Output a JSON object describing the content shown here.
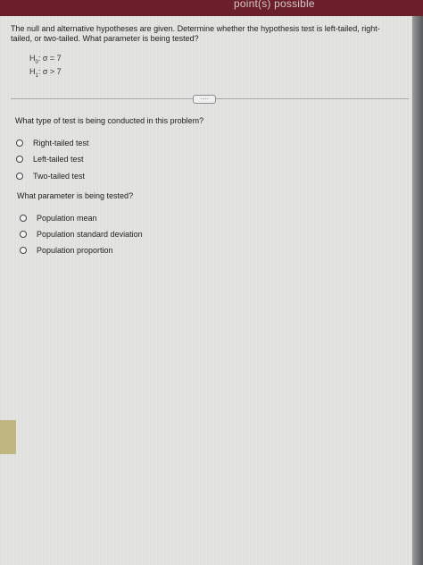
{
  "header": {
    "points_label": "point(s) possible"
  },
  "question": {
    "prompt": "The null and alternative hypotheses are given. Determine whether the hypothesis test is left-tailed, right-tailed, or two-tailed. What parameter is being tested?",
    "h0": {
      "symbol": "H",
      "subscript": "0",
      "statement": ": σ = 7"
    },
    "h1": {
      "symbol": "H",
      "subscript": "1",
      "statement": ": σ > 7"
    },
    "more_button": "....."
  },
  "part1": {
    "question": "What type of test is being conducted in this problem?",
    "options": [
      "Right-tailed test",
      "Left-tailed test",
      "Two-tailed test"
    ]
  },
  "part2": {
    "question": "What parameter is being tested?",
    "options": [
      "Population mean",
      "Population standard deviation",
      "Population proportion"
    ]
  }
}
